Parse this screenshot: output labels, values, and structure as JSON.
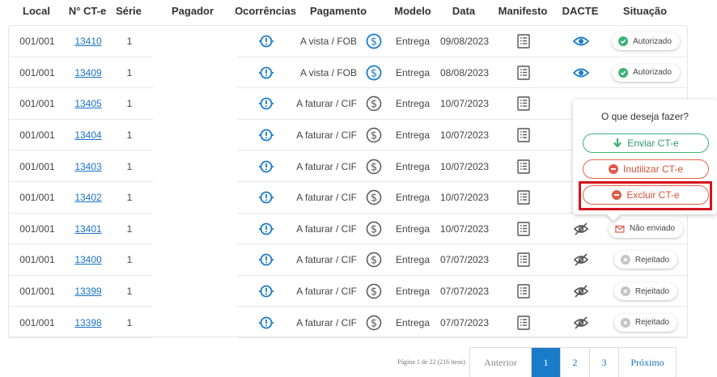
{
  "columns": [
    "Local",
    "N° CT-e",
    "Série",
    "Pagador",
    "Ocorrências",
    "Pagamento",
    "Modelo",
    "Data",
    "Manifesto",
    "DACTE",
    "Situação"
  ],
  "rows": [
    {
      "local": "001/001",
      "numero": "13410",
      "serie": "1",
      "pagamento": "A vista / FOB",
      "pay_active": true,
      "modelo": "Entrega",
      "data": "09/08/2023",
      "dacte": "eye",
      "situacao": "Autorizado",
      "status": "ok"
    },
    {
      "local": "001/001",
      "numero": "13409",
      "serie": "1",
      "pagamento": "A vista / FOB",
      "pay_active": true,
      "modelo": "Entrega",
      "data": "08/08/2023",
      "dacte": "eye",
      "situacao": "Autorizado",
      "status": "ok"
    },
    {
      "local": "001/001",
      "numero": "13405",
      "serie": "1",
      "pagamento": "A faturar / CIF",
      "pay_active": false,
      "modelo": "Entrega",
      "data": "10/07/2023",
      "dacte": "none",
      "situacao": "",
      "status": "hidden"
    },
    {
      "local": "001/001",
      "numero": "13404",
      "serie": "1",
      "pagamento": "A faturar / CIF",
      "pay_active": false,
      "modelo": "Entrega",
      "data": "10/07/2023",
      "dacte": "none",
      "situacao": "",
      "status": "hidden"
    },
    {
      "local": "001/001",
      "numero": "13403",
      "serie": "1",
      "pagamento": "A faturar / CIF",
      "pay_active": false,
      "modelo": "Entrega",
      "data": "10/07/2023",
      "dacte": "none",
      "situacao": "",
      "status": "hidden"
    },
    {
      "local": "001/001",
      "numero": "13402",
      "serie": "1",
      "pagamento": "A faturar / CIF",
      "pay_active": false,
      "modelo": "Entrega",
      "data": "10/07/2023",
      "dacte": "none",
      "situacao": "",
      "status": "hidden"
    },
    {
      "local": "001/001",
      "numero": "13401",
      "serie": "1",
      "pagamento": "A faturar / CIF",
      "pay_active": false,
      "modelo": "Entrega",
      "data": "10/07/2023",
      "dacte": "eye-off",
      "situacao": "Não enviado",
      "status": "notsent"
    },
    {
      "local": "001/001",
      "numero": "13400",
      "serie": "1",
      "pagamento": "A faturar / CIF",
      "pay_active": false,
      "modelo": "Entrega",
      "data": "07/07/2023",
      "dacte": "eye-off",
      "situacao": "Rejeitado",
      "status": "rejected"
    },
    {
      "local": "001/001",
      "numero": "13399",
      "serie": "1",
      "pagamento": "A faturar / CIF",
      "pay_active": false,
      "modelo": "Entrega",
      "data": "07/07/2023",
      "dacte": "eye-off",
      "situacao": "Rejeitado",
      "status": "rejected"
    },
    {
      "local": "001/001",
      "numero": "13398",
      "serie": "1",
      "pagamento": "A faturar / CIF",
      "pay_active": false,
      "modelo": "Entrega",
      "data": "07/07/2023",
      "dacte": "eye-off",
      "situacao": "Rejeitado",
      "status": "rejected"
    }
  ],
  "popover": {
    "title": "O que deseja fazer?",
    "send_label": "Enviar CT-e",
    "inutilizar_label": "Inutilizar CT-e",
    "excluir_label": "Excluir CT-e"
  },
  "pagination": {
    "info": "Página 1 de 22 (216 itens)",
    "prev": "Anterior",
    "pages": [
      "1",
      "2",
      "3"
    ],
    "current": "1",
    "next": "Próximo"
  },
  "colors": {
    "link": "#1a73c8",
    "ok": "#3cb371",
    "rejected": "#c4c4c4",
    "notsent": "#e05a4a",
    "send": "#2d9b66",
    "danger": "#d6513a",
    "highlight": "#d4131e"
  }
}
